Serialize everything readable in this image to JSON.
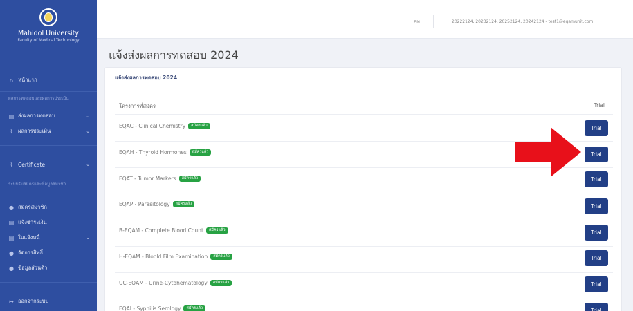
{
  "sidebar": {
    "brand_name": "Mahidol University",
    "brand_sub": "Faculty of Medical Technology",
    "home": "หน้าแรก",
    "section1": "ผลการทดสอบและผลการประเมิน",
    "submit_results": "ส่งผลการทดสอบ",
    "evaluation": "ผลการประเมิน",
    "certificate": "Certificate",
    "section2": "ระบบรับสมัครและข้อมูลสมาชิก",
    "register": "สมัครสมาชิก",
    "payment": "แจ้งชำระเงิน",
    "receipt": "ใบแจ้งหนี้",
    "rights": "จัดการสิทธิ์",
    "profile": "ข้อมูลส่วนตัว",
    "logout": "ออกจากระบบ"
  },
  "topbar": {
    "lang": "EN",
    "user": "20222124, 20232124, 20252124, 20242124 - test1@eqamunit.com"
  },
  "page": {
    "title": "แจ้งส่งผลการทดสอบ 2024",
    "card_title": "แจ้งส่งผลการทดสอบ 2024",
    "col_program": "โครงการที่สมัคร",
    "col_trial": "Trial"
  },
  "badge_label": "สมัครแล้ว",
  "button_label": "Trial",
  "rows": [
    {
      "name": "EQAC - Clinical Chemistry"
    },
    {
      "name": "EQAH - Thyroid Hormones"
    },
    {
      "name": "EQAT - Tumor Markers"
    },
    {
      "name": "EQAP - Parasitology"
    },
    {
      "name": "B-EQAM - Complete Blood Count"
    },
    {
      "name": "H-EQAM - Bloold Film Examination"
    },
    {
      "name": "UC-EQAM - Urine-Cytohematology"
    },
    {
      "name": "EQAI - Syphilis Serology"
    }
  ],
  "colors": {
    "sidebar_bg": "#2e4ea0",
    "button_bg": "#223f86",
    "badge_bg": "#27a243",
    "arrow": "#e8101a"
  },
  "icons": {
    "logo": "university-seal-icon",
    "arrow": "red-arrow-icon"
  }
}
